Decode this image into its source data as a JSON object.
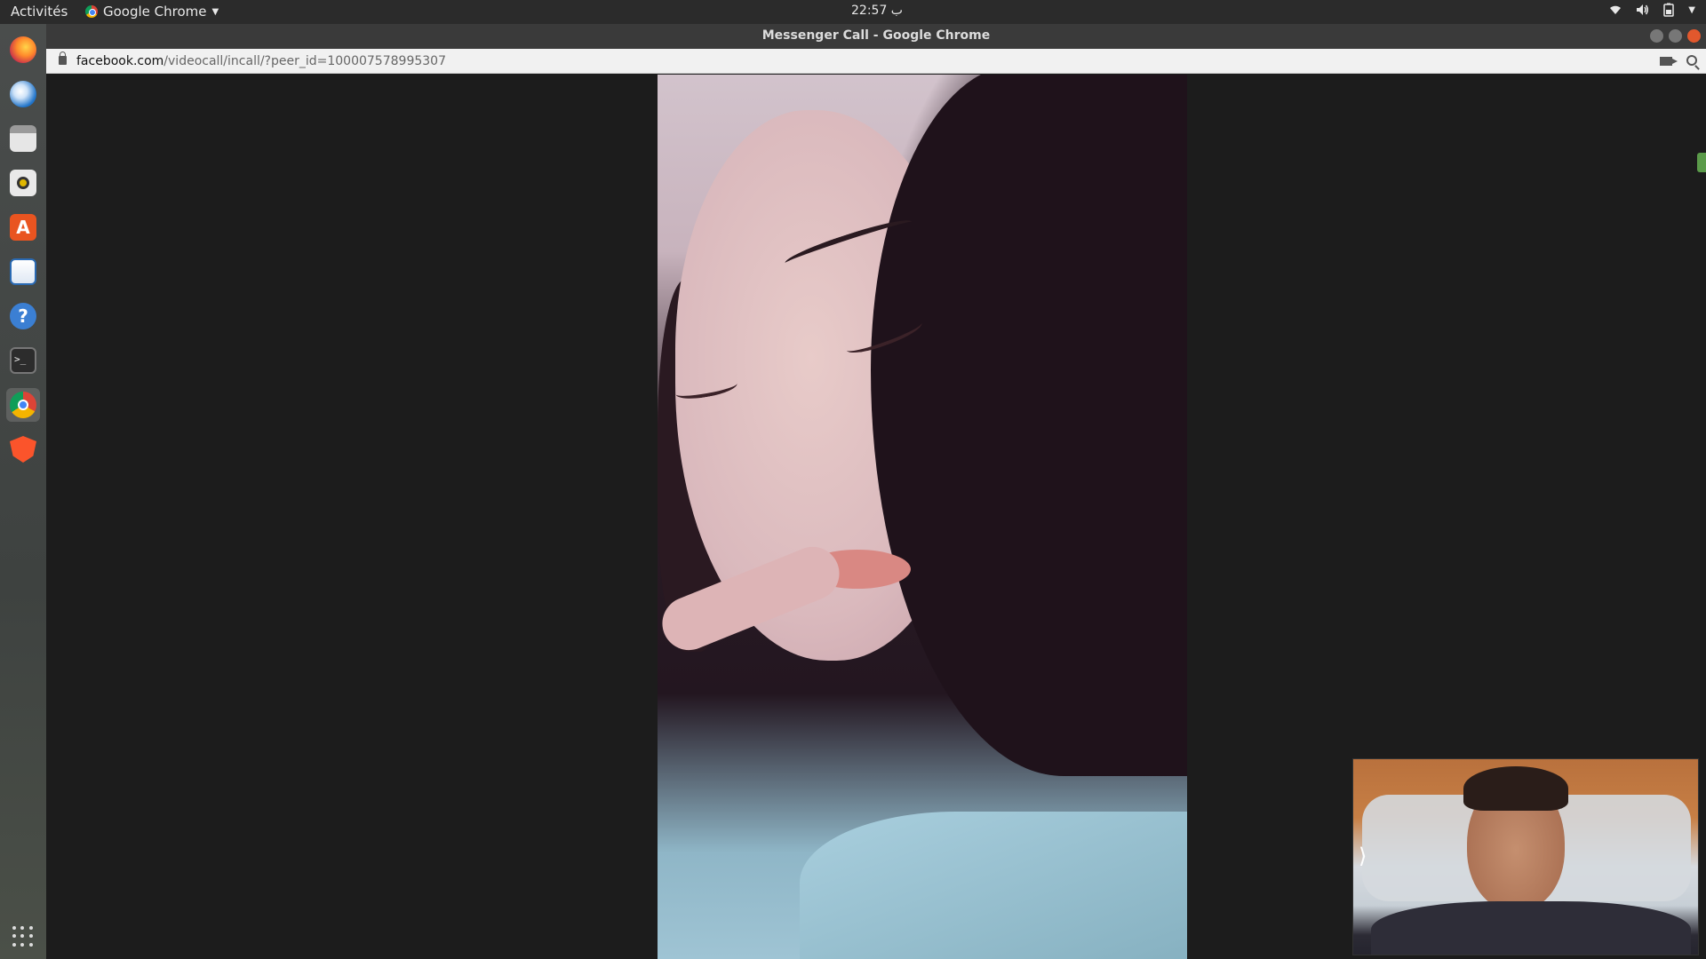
{
  "topbar": {
    "activities": "Activités",
    "app_name": "Google Chrome",
    "clock": "22:57 ب",
    "tray_icons": [
      "wifi-icon",
      "volume-icon",
      "battery-icon",
      "menu-caret-icon"
    ]
  },
  "window": {
    "title": "Messenger Call - Google Chrome"
  },
  "address_bar": {
    "host": "facebook.com",
    "path": "/videocall/incall/?peer_id=100007578995307"
  },
  "dock": {
    "apps": [
      "firefox-icon",
      "thunderbird-icon",
      "files-icon",
      "rhythmbox-icon",
      "software-center-icon",
      "libreoffice-writer-icon",
      "help-icon",
      "terminal-icon",
      "chrome-icon",
      "brave-icon"
    ],
    "active_app": "chrome-icon",
    "show_apps": "app-grid-icon"
  },
  "colors": {
    "topbar": "#2b2b2b",
    "titlebar": "#3a3a3a",
    "close_button": "#e2582d",
    "call_background": "#1c1c1c"
  }
}
